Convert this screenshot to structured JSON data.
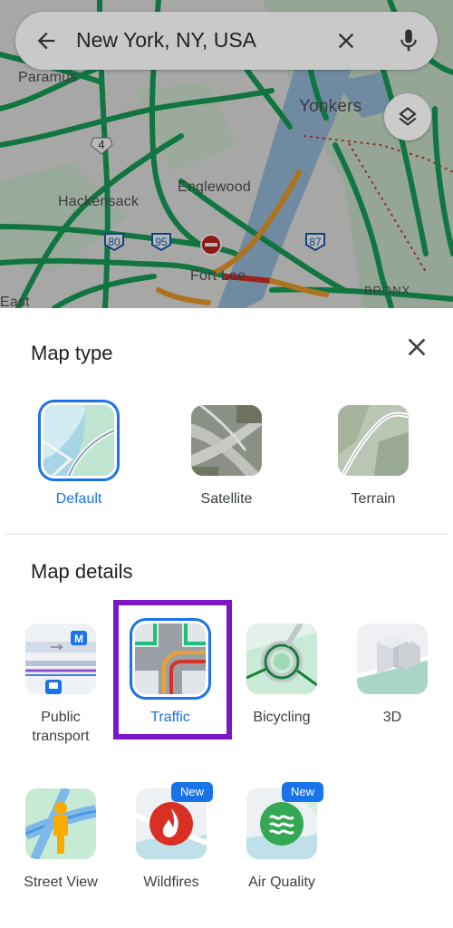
{
  "map": {
    "places": [
      {
        "key": "paramus",
        "label": "Paramus"
      },
      {
        "key": "yonkers",
        "label": "Yonkers"
      },
      {
        "key": "englewood",
        "label": "Englewood"
      },
      {
        "key": "hackensack",
        "label": "Hackensack"
      },
      {
        "key": "fort_lee",
        "label": "Fort Lee"
      },
      {
        "key": "bronx",
        "label": "BRONX"
      },
      {
        "key": "east",
        "label": "East"
      }
    ],
    "shields": [
      "4",
      "80",
      "95",
      "87"
    ],
    "colors": {
      "traffic_green": "#17a35a",
      "traffic_orange": "#f0a02c",
      "traffic_red": "#d93025",
      "water": "#9cc0e0"
    }
  },
  "search": {
    "query": "New York, NY, USA",
    "back_icon": "arrow-left-icon",
    "clear_icon": "close-icon",
    "mic_icon": "microphone-icon"
  },
  "layers_button": {
    "icon": "layers-icon"
  },
  "sheet": {
    "map_type_title": "Map type",
    "close_icon": "close-icon",
    "map_types": [
      {
        "label": "Default",
        "selected": true
      },
      {
        "label": "Satellite",
        "selected": false
      },
      {
        "label": "Terrain",
        "selected": false
      }
    ],
    "map_details_title": "Map details",
    "details": [
      {
        "label": "Public\ntransport",
        "selected": false
      },
      {
        "label": "Traffic",
        "selected": true
      },
      {
        "label": "Bicycling",
        "selected": false
      },
      {
        "label": "3D",
        "selected": false
      },
      {
        "label": "Street View",
        "selected": false
      },
      {
        "label": "Wildfires",
        "selected": false,
        "badge": "New"
      },
      {
        "label": "Air Quality",
        "selected": false,
        "badge": "New"
      }
    ],
    "accent_color": "#1a73e8",
    "highlight_color": "#7b16c9"
  }
}
